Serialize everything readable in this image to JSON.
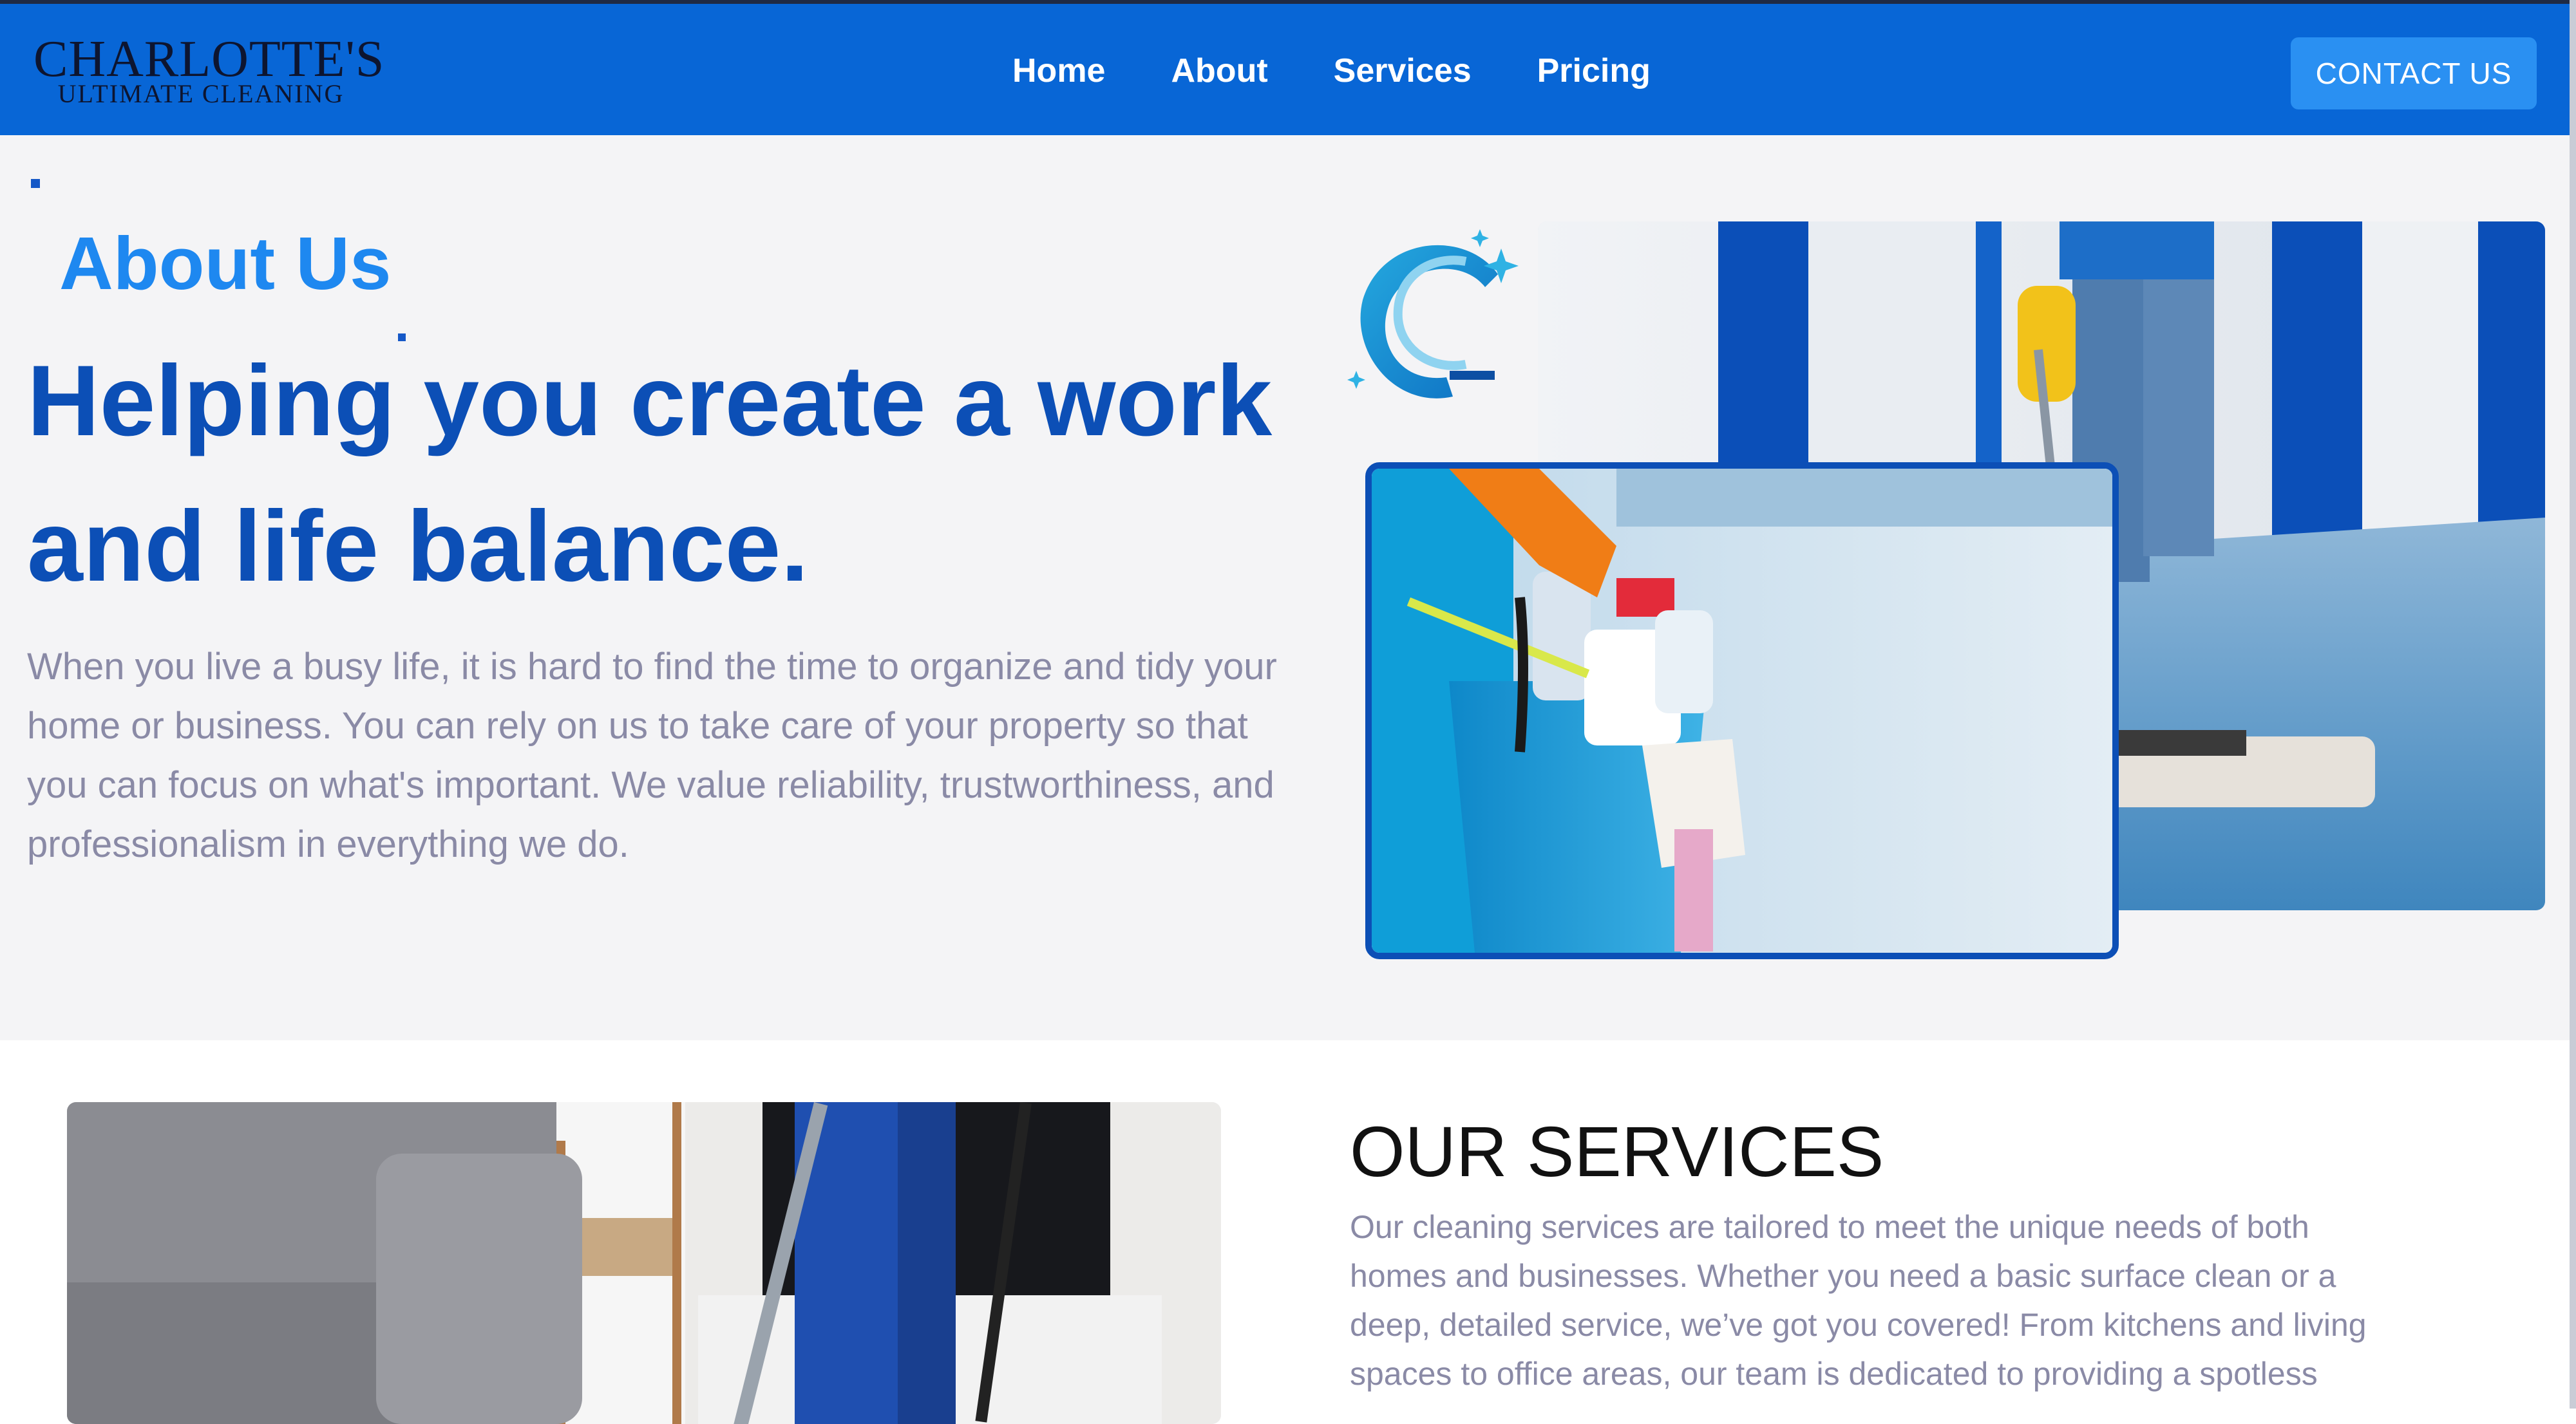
{
  "nav": {
    "logo_main": "CHARLOTTE'S",
    "logo_sub": "ULTIMATE CLEANING",
    "links": [
      "Home",
      "About",
      "Services",
      "Pricing"
    ],
    "contact_label": "CONTACT US",
    "colors": {
      "bar": "#0866d6",
      "button": "#2a90f2"
    }
  },
  "about": {
    "eyebrow": "About Us",
    "headline": "Helping you create a work and life balance.",
    "body": "When you live a busy life, it is hard to find the time to organize and tidy your home or business. You can rely on us to take care of your property so that you can focus on what's important. We value reliability, trustworthiness, and professionalism in everything we do.",
    "colors": {
      "eyebrow": "#1e88f0",
      "headline": "#0c4fb6",
      "body": "#8a8aa6"
    }
  },
  "services": {
    "title": "OUR SERVICES",
    "body": "Our cleaning services are tailored to meet the unique needs of both homes and businesses. Whether you need a basic surface clean or a deep, detailed service, we’ve got you covered! From kitchens and living spaces to office areas, our team is dedicated to providing a spotless"
  },
  "icons": [
    "sparkle-swoosh-logo-icon",
    "hallway-mopping-photo",
    "cleaning-bucket-photo",
    "living-room-vacuum-photo"
  ]
}
